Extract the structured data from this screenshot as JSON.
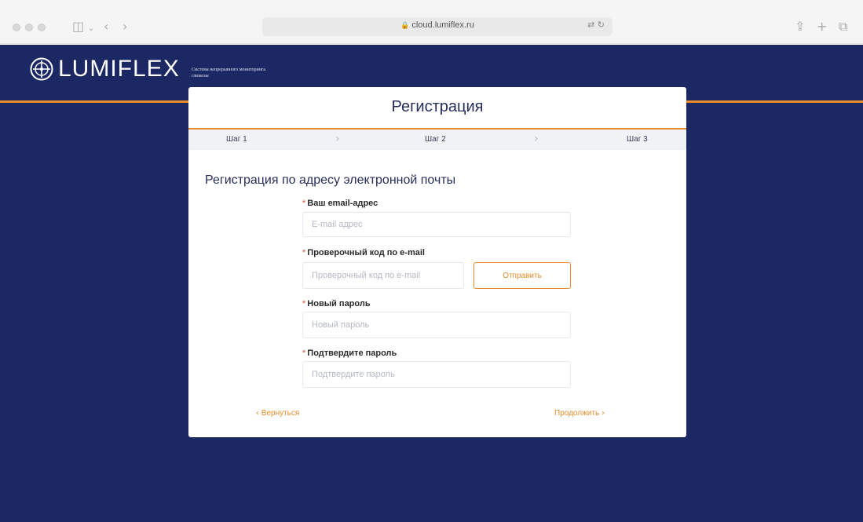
{
  "browser": {
    "url": "cloud.lumiflex.ru"
  },
  "brand": {
    "name": "LUMIFLEX",
    "tagline": "Система непрерывного мониторинга глюкозы"
  },
  "card": {
    "title": "Регистрация",
    "steps": [
      "Шаг 1",
      "Шаг 2",
      "Шаг 3"
    ],
    "section_title": "Регистрация по адресу электронной почты",
    "fields": {
      "email": {
        "label": "Ваш email-адрес",
        "placeholder": "E-mail адрес",
        "value": ""
      },
      "code": {
        "label": "Проверочный код по e-mail",
        "placeholder": "Проверочный код по e-mail",
        "value": ""
      },
      "password": {
        "label": "Новый пароль",
        "placeholder": "Новый пароль",
        "value": ""
      },
      "confirm": {
        "label": "Подтвердите пароль",
        "placeholder": "Подтвердите пароль",
        "value": ""
      }
    },
    "required_mark": "*",
    "send_button": "Отправить",
    "back_link": "Вернуться",
    "continue_link": "Продолжить"
  },
  "colors": {
    "background": "#1c2864",
    "accent": "#e98d2c",
    "required": "#e2453f"
  }
}
